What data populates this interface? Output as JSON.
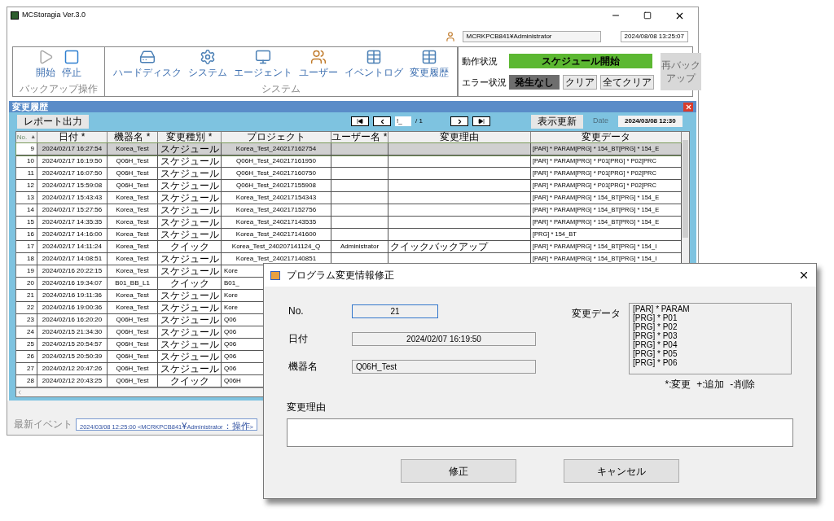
{
  "window": {
    "title": "MCStoragia Ver.3.0"
  },
  "user_bar": {
    "user": "MCRKPCB841¥Administrator",
    "datetime": "2024/08/08 13:25:07"
  },
  "toolbar": {
    "groups": [
      {
        "label": "バックアップ操作",
        "items": [
          {
            "label": "開始",
            "disabled": true
          },
          {
            "label": "停止",
            "disabled": false
          }
        ]
      },
      {
        "label": "システム",
        "items": [
          {
            "label": "ハードディスク",
            "disabled": false
          },
          {
            "label": "システム",
            "disabled": false
          },
          {
            "label": "エージェント",
            "disabled": false
          },
          {
            "label": "ユーザー",
            "disabled": false
          },
          {
            "label": "イベントログ",
            "disabled": false
          },
          {
            "label": "変更履歴",
            "disabled": false
          }
        ]
      }
    ]
  },
  "status": {
    "operation_label": "動作状況",
    "operation": "スケジュール開始",
    "error_label": "エラー状況",
    "error": "発生なし",
    "buttons": [
      "クリア",
      "全てクリア"
    ],
    "rebackup": {
      "label": "再バックアップ",
      "disabled": true
    }
  },
  "history_panel": {
    "title": "変更履歴",
    "report_button": "レポート出力",
    "page_input": "!_",
    "page_total": "/ 1",
    "refresh_button": "表示更新",
    "date_label": "Date",
    "date": "2024/03/08 12:30",
    "columns": [
      {
        "label": "No.",
        "sort": "▲"
      },
      {
        "label": "日付 *"
      },
      {
        "label": "機器名 *"
      },
      {
        "label": "変更種別 *"
      },
      {
        "label": "プロジェクト"
      },
      {
        "label": "ユーザー名 *"
      },
      {
        "label": "変更理由"
      },
      {
        "label": "変更データ"
      }
    ],
    "rows": [
      {
        "no": "9",
        "date": "2024/02/17 16:27:54",
        "device": "Korea_Test",
        "type": "スケジュール",
        "project": "Korea_Test_240217162754",
        "change_data": "[PAR] * PARAM[PRG] * 154_BT[PRG] * 154_E",
        "selected": true
      },
      {
        "no": "10",
        "date": "2024/02/17 16:19:50",
        "device": "Q06H_Test",
        "type": "スケジュール",
        "project": "Q06H_Test_240217161950",
        "change_data": "[PAR] * PARAM[PRG] * P01[PRG] * P02[PRC",
        "selected": false
      },
      {
        "no": "11",
        "date": "2024/02/17 16:07:50",
        "device": "Q06H_Test",
        "type": "スケジュール",
        "project": "Q06H_Test_240217160750",
        "change_data": "[PAR] * PARAM[PRG] * P01[PRG] * P02[PRC",
        "selected": false
      },
      {
        "no": "12",
        "date": "2024/02/17 15:59:08",
        "device": "Q06H_Test",
        "type": "スケジュール",
        "project": "Q06H_Test_240217155908",
        "change_data": "[PAR] * PARAM[PRG] * P01[PRG] * P02[PRC",
        "selected": false
      },
      {
        "no": "13",
        "date": "2024/02/17 15:43:43",
        "device": "Korea_Test",
        "type": "スケジュール",
        "project": "Korea_Test_240217154343",
        "change_data": "[PAR] * PARAM[PRG] * 154_BT[PRG] * 154_E",
        "selected": false
      },
      {
        "no": "14",
        "date": "2024/02/17 15:27:56",
        "device": "Korea_Test",
        "type": "スケジュール",
        "project": "Korea_Test_240217152756",
        "change_data": "[PAR] * PARAM[PRG] * 154_BT[PRG] * 154_E",
        "selected": false
      },
      {
        "no": "15",
        "date": "2024/02/17 14:35:35",
        "device": "Korea_Test",
        "type": "スケジュール",
        "project": "Korea_Test_240217143535",
        "change_data": "[PAR] * PARAM[PRG] * 154_BT[PRG] * 154_E",
        "selected": false
      },
      {
        "no": "16",
        "date": "2024/02/17 14:16:00",
        "device": "Korea_Test",
        "type": "スケジュール",
        "project": "Korea_Test_240217141600",
        "change_data": "[PRG] * 154_BT",
        "selected": false
      },
      {
        "no": "17",
        "date": "2024/02/17 14:11:24",
        "device": "Korea_Test",
        "type": "クイック",
        "project": "Korea_Test_240207141124_Q",
        "user": "Administrator",
        "reason": "クイックバックアップ",
        "change_data": "[PAR] * PARAM[PRG] * 154_BT[PRG] * 154_I",
        "selected": false
      },
      {
        "no": "18",
        "date": "2024/02/17 14:08:51",
        "device": "Korea_Test",
        "type": "スケジュール",
        "project": "Korea_Test_240217140851",
        "change_data": "[PAR] * PARAM[PRG] * 154_BT[PRG] * 154_I",
        "selected": false
      },
      {
        "no": "19",
        "date": "2024/02/16 20:22:15",
        "device": "Korea_Test",
        "type": "スケジュール",
        "project": "Kore",
        "selected": false
      },
      {
        "no": "20",
        "date": "2024/02/16 19:34:07",
        "device": "B01_BB_L1",
        "type": "クイック",
        "project": "B01_",
        "selected": false
      },
      {
        "no": "21",
        "date": "2024/02/16 19:11:36",
        "device": "Korea_Test",
        "type": "スケジュール",
        "project": "Kore",
        "selected": false
      },
      {
        "no": "22",
        "date": "2024/02/16 19:00:36",
        "device": "Korea_Test",
        "type": "スケジュール",
        "project": "Kore",
        "selected": false
      },
      {
        "no": "23",
        "date": "2024/02/16 16:20:20",
        "device": "Q06H_Test",
        "type": "スケジュール",
        "project": "Q06",
        "selected": false
      },
      {
        "no": "24",
        "date": "2024/02/15 21:34:30",
        "device": "Q06H_Test",
        "type": "スケジュール",
        "project": "Q06",
        "selected": false
      },
      {
        "no": "25",
        "date": "2024/02/15 20:54:57",
        "device": "Q06H_Test",
        "type": "スケジュール",
        "project": "Q06",
        "selected": false
      },
      {
        "no": "26",
        "date": "2024/02/15 20:50:39",
        "device": "Q06H_Test",
        "type": "スケジュール",
        "project": "Q06",
        "selected": false
      },
      {
        "no": "27",
        "date": "2024/02/12 20:47:26",
        "device": "Q06H_Test",
        "type": "スケジュール",
        "project": "Q06",
        "selected": false
      },
      {
        "no": "28",
        "date": "2024/02/12 20:43:25",
        "device": "Q06H_Test",
        "type": "クイック",
        "project": "Q06H",
        "selected": false
      }
    ]
  },
  "footer": {
    "label": "最新イベント",
    "event": "2024/03/08 12:25:00  <MCRKPCB841¥Administrator：操作>"
  },
  "dialog": {
    "title": "プログラム変更情報修正",
    "fields": [
      {
        "label": "No.",
        "value": "21",
        "focused": true
      },
      {
        "label": "日付",
        "value": "2024/02/07 16:19:50",
        "focused": false
      },
      {
        "label": "機器名",
        "value": "Q06H_Test",
        "focused": false
      }
    ],
    "change_data_label": "変更データ",
    "change_data_lines": [
      "[PAR] * PARAM",
      "[PRG] * P01",
      "[PRG] * P02",
      "[PRG] * P03",
      "[PRG] * P04",
      "[PRG] * P05",
      "[PRG] * P06"
    ],
    "legend": "*:変更  +:追加  -:削除",
    "reason_label": "変更理由",
    "buttons": [
      "修正",
      "キャンセル"
    ]
  }
}
